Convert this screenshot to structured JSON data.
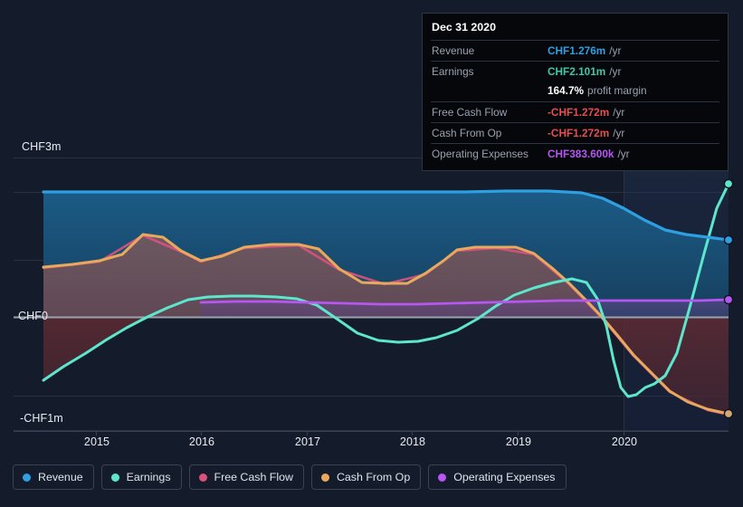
{
  "chart_data": {
    "type": "area",
    "title": "",
    "currency": "CHF",
    "xlabel": "",
    "ylabel": "",
    "x_ticks": [
      "2015",
      "2016",
      "2017",
      "2018",
      "2019",
      "2020"
    ],
    "y_ticks": [
      "CHF3m",
      "CHF0",
      "-CHF1m"
    ],
    "ylim": [
      -1.3,
      3.0
    ],
    "xlim": [
      2014.4,
      2021.0
    ],
    "grid": true,
    "legend_position": "bottom-left",
    "forecast_region": {
      "from": "2020",
      "to": "2021",
      "label": ""
    },
    "series": [
      {
        "name": "Revenue",
        "color": "#2e9fe0",
        "fill": "#1d4f75",
        "x": [
          2014.42,
          2015.0,
          2015.5,
          2016.0,
          2016.5,
          2017.0,
          2017.5,
          2018.0,
          2018.5,
          2019.0,
          2019.3,
          2019.7,
          2020.0,
          2020.4,
          2020.8,
          2021.0
        ],
        "values": [
          2.2,
          2.2,
          2.2,
          2.2,
          2.2,
          2.2,
          2.2,
          2.2,
          2.2,
          2.2,
          2.18,
          2.0,
          1.75,
          1.52,
          1.35,
          1.276
        ]
      },
      {
        "name": "Earnings",
        "color": "#5ee6cd",
        "fill": "#6b4a52",
        "x": [
          2014.42,
          2015.0,
          2015.6,
          2016.0,
          2016.5,
          2017.0,
          2017.4,
          2017.8,
          2018.2,
          2018.6,
          2019.0,
          2019.3,
          2019.6,
          2019.9,
          2020.1,
          2020.4,
          2020.6,
          2020.8,
          2021.0
        ],
        "values": [
          -1.06,
          -0.58,
          -0.12,
          0.19,
          0.19,
          0.17,
          0.02,
          -0.18,
          -0.2,
          -0.04,
          0.42,
          0.62,
          0.68,
          0.33,
          -0.56,
          -0.78,
          -0.7,
          0.55,
          2.101
        ]
      },
      {
        "name": "Free Cash Flow",
        "color": "#d9527e",
        "fill": "#6b4a52",
        "x": [
          2014.42,
          2016.0,
          2018.0,
          2020.0,
          2021.0
        ],
        "values": [
          0.6,
          0.7,
          0.62,
          0.1,
          -1.272
        ]
      },
      {
        "name": "Cash From Op",
        "color": "#e8a95c",
        "fill": "#6b4a52",
        "x": [
          2014.42,
          2015.0,
          2015.5,
          2016.0,
          2016.4,
          2017.0,
          2017.4,
          2017.8,
          2018.3,
          2018.8,
          2019.1,
          2019.5,
          2019.8,
          2020.0,
          2020.3,
          2020.6,
          2021.0
        ],
        "values": [
          0.6,
          0.72,
          0.95,
          0.7,
          0.8,
          0.82,
          0.62,
          0.62,
          0.88,
          0.92,
          0.9,
          0.62,
          0.1,
          -0.3,
          -0.8,
          -1.08,
          -1.272
        ]
      },
      {
        "name": "Operating Expenses",
        "color": "#b557f0",
        "fill": "#4b3a6b",
        "x": [
          2016.0,
          2017.0,
          2018.0,
          2019.0,
          2020.0,
          2021.0
        ],
        "values": [
          0.26,
          0.27,
          0.24,
          0.27,
          0.28,
          0.3836
        ]
      }
    ],
    "endpoints": [
      {
        "series": "Earnings",
        "color": "#5ee6cd"
      },
      {
        "series": "Revenue",
        "color": "#2e9fe0"
      },
      {
        "series": "Operating Expenses",
        "color": "#b557f0"
      },
      {
        "series": "Cash From Op",
        "color": "#d6a873"
      }
    ]
  },
  "tooltip": {
    "date": "Dec 31 2020",
    "rows": [
      {
        "label": "Revenue",
        "value": "CHF1.276m",
        "unit": "/yr",
        "color": "#2e9fe0"
      },
      {
        "label": "Earnings",
        "value": "CHF2.101m",
        "unit": "/yr",
        "color": "#3fc9a8"
      },
      {
        "label": "Free Cash Flow",
        "value": "-CHF1.272m",
        "unit": "/yr",
        "color": "#e84d4d"
      },
      {
        "label": "Cash From Op",
        "value": "-CHF1.272m",
        "unit": "/yr",
        "color": "#e84d4d"
      },
      {
        "label": "Operating Expenses",
        "value": "CHF383.600k",
        "unit": "/yr",
        "color": "#b557f0"
      }
    ],
    "profit_margin_value": "164.7%",
    "profit_margin_label": "profit margin"
  },
  "legend": {
    "items": [
      {
        "label": "Revenue",
        "color": "#2e9fe0"
      },
      {
        "label": "Earnings",
        "color": "#5ee6cd"
      },
      {
        "label": "Free Cash Flow",
        "color": "#d9527e"
      },
      {
        "label": "Cash From Op",
        "color": "#e8a95c"
      },
      {
        "label": "Operating Expenses",
        "color": "#b557f0"
      }
    ]
  },
  "axis": {
    "y_top": "CHF3m",
    "y_zero": "CHF0",
    "y_bottom": "-CHF1m",
    "x": [
      "2015",
      "2016",
      "2017",
      "2018",
      "2019",
      "2020"
    ]
  }
}
